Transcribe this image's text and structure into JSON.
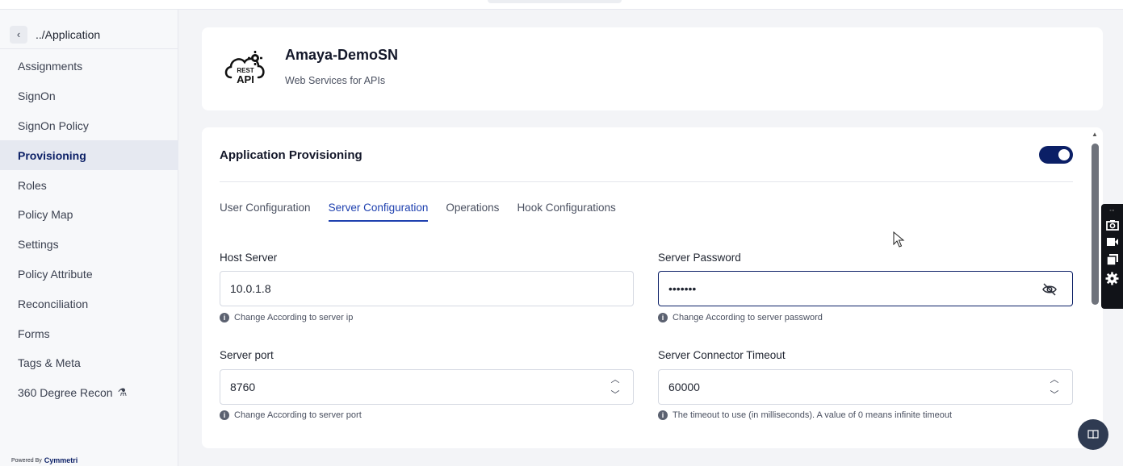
{
  "breadcrumb": {
    "back_label": "../Application"
  },
  "sidebar": {
    "items": [
      {
        "label": "Assignments"
      },
      {
        "label": "SignOn"
      },
      {
        "label": "SignOn Policy"
      },
      {
        "label": "Provisioning",
        "active": true
      },
      {
        "label": "Roles"
      },
      {
        "label": "Policy Map"
      },
      {
        "label": "Settings"
      },
      {
        "label": "Policy Attribute"
      },
      {
        "label": "Reconciliation"
      },
      {
        "label": "Forms"
      },
      {
        "label": "Tags & Meta"
      },
      {
        "label": "360 Degree Recon",
        "icon": "flask-icon"
      }
    ],
    "powered_by": "Powered By",
    "brand": "Cymmetri"
  },
  "header": {
    "app_name": "Amaya-DemoSN",
    "app_desc": "Web Services for APIs",
    "logo_text_top": "REST",
    "logo_text_bottom": "API"
  },
  "provisioning": {
    "title": "Application Provisioning",
    "enabled": true,
    "tabs": [
      {
        "label": "User Configuration"
      },
      {
        "label": "Server Configuration",
        "active": true
      },
      {
        "label": "Operations"
      },
      {
        "label": "Hook Configurations"
      }
    ],
    "fields": {
      "host_server": {
        "label": "Host Server",
        "value": "10.0.1.8",
        "hint": "Change According to server ip"
      },
      "server_password": {
        "label": "Server Password",
        "value": "•••••••",
        "hint": "Change According to server password"
      },
      "server_port": {
        "label": "Server port",
        "value": "8760",
        "hint": "Change According to server port"
      },
      "connector_timeout": {
        "label": "Server Connector Timeout",
        "value": "60000",
        "hint": "The timeout to use (in milliseconds). A value of 0 means infinite timeout"
      }
    }
  },
  "colors": {
    "brand_navy": "#0b1f66",
    "active_tab": "#1e40af",
    "background": "#f3f4f7"
  }
}
